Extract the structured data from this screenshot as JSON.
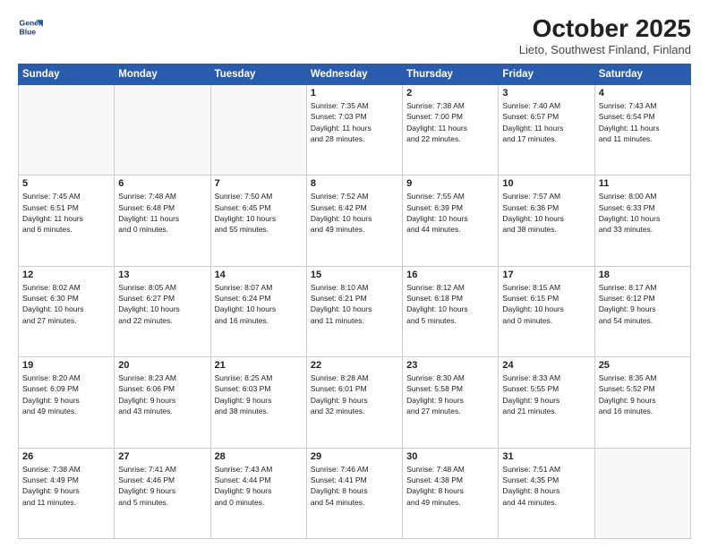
{
  "logo": {
    "line1": "General",
    "line2": "Blue"
  },
  "title": "October 2025",
  "subtitle": "Lieto, Southwest Finland, Finland",
  "days_header": [
    "Sunday",
    "Monday",
    "Tuesday",
    "Wednesday",
    "Thursday",
    "Friday",
    "Saturday"
  ],
  "weeks": [
    [
      {
        "num": "",
        "info": ""
      },
      {
        "num": "",
        "info": ""
      },
      {
        "num": "",
        "info": ""
      },
      {
        "num": "1",
        "info": "Sunrise: 7:35 AM\nSunset: 7:03 PM\nDaylight: 11 hours\nand 28 minutes."
      },
      {
        "num": "2",
        "info": "Sunrise: 7:38 AM\nSunset: 7:00 PM\nDaylight: 11 hours\nand 22 minutes."
      },
      {
        "num": "3",
        "info": "Sunrise: 7:40 AM\nSunset: 6:57 PM\nDaylight: 11 hours\nand 17 minutes."
      },
      {
        "num": "4",
        "info": "Sunrise: 7:43 AM\nSunset: 6:54 PM\nDaylight: 11 hours\nand 11 minutes."
      }
    ],
    [
      {
        "num": "5",
        "info": "Sunrise: 7:45 AM\nSunset: 6:51 PM\nDaylight: 11 hours\nand 6 minutes."
      },
      {
        "num": "6",
        "info": "Sunrise: 7:48 AM\nSunset: 6:48 PM\nDaylight: 11 hours\nand 0 minutes."
      },
      {
        "num": "7",
        "info": "Sunrise: 7:50 AM\nSunset: 6:45 PM\nDaylight: 10 hours\nand 55 minutes."
      },
      {
        "num": "8",
        "info": "Sunrise: 7:52 AM\nSunset: 6:42 PM\nDaylight: 10 hours\nand 49 minutes."
      },
      {
        "num": "9",
        "info": "Sunrise: 7:55 AM\nSunset: 6:39 PM\nDaylight: 10 hours\nand 44 minutes."
      },
      {
        "num": "10",
        "info": "Sunrise: 7:57 AM\nSunset: 6:36 PM\nDaylight: 10 hours\nand 38 minutes."
      },
      {
        "num": "11",
        "info": "Sunrise: 8:00 AM\nSunset: 6:33 PM\nDaylight: 10 hours\nand 33 minutes."
      }
    ],
    [
      {
        "num": "12",
        "info": "Sunrise: 8:02 AM\nSunset: 6:30 PM\nDaylight: 10 hours\nand 27 minutes."
      },
      {
        "num": "13",
        "info": "Sunrise: 8:05 AM\nSunset: 6:27 PM\nDaylight: 10 hours\nand 22 minutes."
      },
      {
        "num": "14",
        "info": "Sunrise: 8:07 AM\nSunset: 6:24 PM\nDaylight: 10 hours\nand 16 minutes."
      },
      {
        "num": "15",
        "info": "Sunrise: 8:10 AM\nSunset: 6:21 PM\nDaylight: 10 hours\nand 11 minutes."
      },
      {
        "num": "16",
        "info": "Sunrise: 8:12 AM\nSunset: 6:18 PM\nDaylight: 10 hours\nand 5 minutes."
      },
      {
        "num": "17",
        "info": "Sunrise: 8:15 AM\nSunset: 6:15 PM\nDaylight: 10 hours\nand 0 minutes."
      },
      {
        "num": "18",
        "info": "Sunrise: 8:17 AM\nSunset: 6:12 PM\nDaylight: 9 hours\nand 54 minutes."
      }
    ],
    [
      {
        "num": "19",
        "info": "Sunrise: 8:20 AM\nSunset: 6:09 PM\nDaylight: 9 hours\nand 49 minutes."
      },
      {
        "num": "20",
        "info": "Sunrise: 8:23 AM\nSunset: 6:06 PM\nDaylight: 9 hours\nand 43 minutes."
      },
      {
        "num": "21",
        "info": "Sunrise: 8:25 AM\nSunset: 6:03 PM\nDaylight: 9 hours\nand 38 minutes."
      },
      {
        "num": "22",
        "info": "Sunrise: 8:28 AM\nSunset: 6:01 PM\nDaylight: 9 hours\nand 32 minutes."
      },
      {
        "num": "23",
        "info": "Sunrise: 8:30 AM\nSunset: 5:58 PM\nDaylight: 9 hours\nand 27 minutes."
      },
      {
        "num": "24",
        "info": "Sunrise: 8:33 AM\nSunset: 5:55 PM\nDaylight: 9 hours\nand 21 minutes."
      },
      {
        "num": "25",
        "info": "Sunrise: 8:35 AM\nSunset: 5:52 PM\nDaylight: 9 hours\nand 16 minutes."
      }
    ],
    [
      {
        "num": "26",
        "info": "Sunrise: 7:38 AM\nSunset: 4:49 PM\nDaylight: 9 hours\nand 11 minutes."
      },
      {
        "num": "27",
        "info": "Sunrise: 7:41 AM\nSunset: 4:46 PM\nDaylight: 9 hours\nand 5 minutes."
      },
      {
        "num": "28",
        "info": "Sunrise: 7:43 AM\nSunset: 4:44 PM\nDaylight: 9 hours\nand 0 minutes."
      },
      {
        "num": "29",
        "info": "Sunrise: 7:46 AM\nSunset: 4:41 PM\nDaylight: 8 hours\nand 54 minutes."
      },
      {
        "num": "30",
        "info": "Sunrise: 7:48 AM\nSunset: 4:38 PM\nDaylight: 8 hours\nand 49 minutes."
      },
      {
        "num": "31",
        "info": "Sunrise: 7:51 AM\nSunset: 4:35 PM\nDaylight: 8 hours\nand 44 minutes."
      },
      {
        "num": "",
        "info": ""
      }
    ]
  ]
}
